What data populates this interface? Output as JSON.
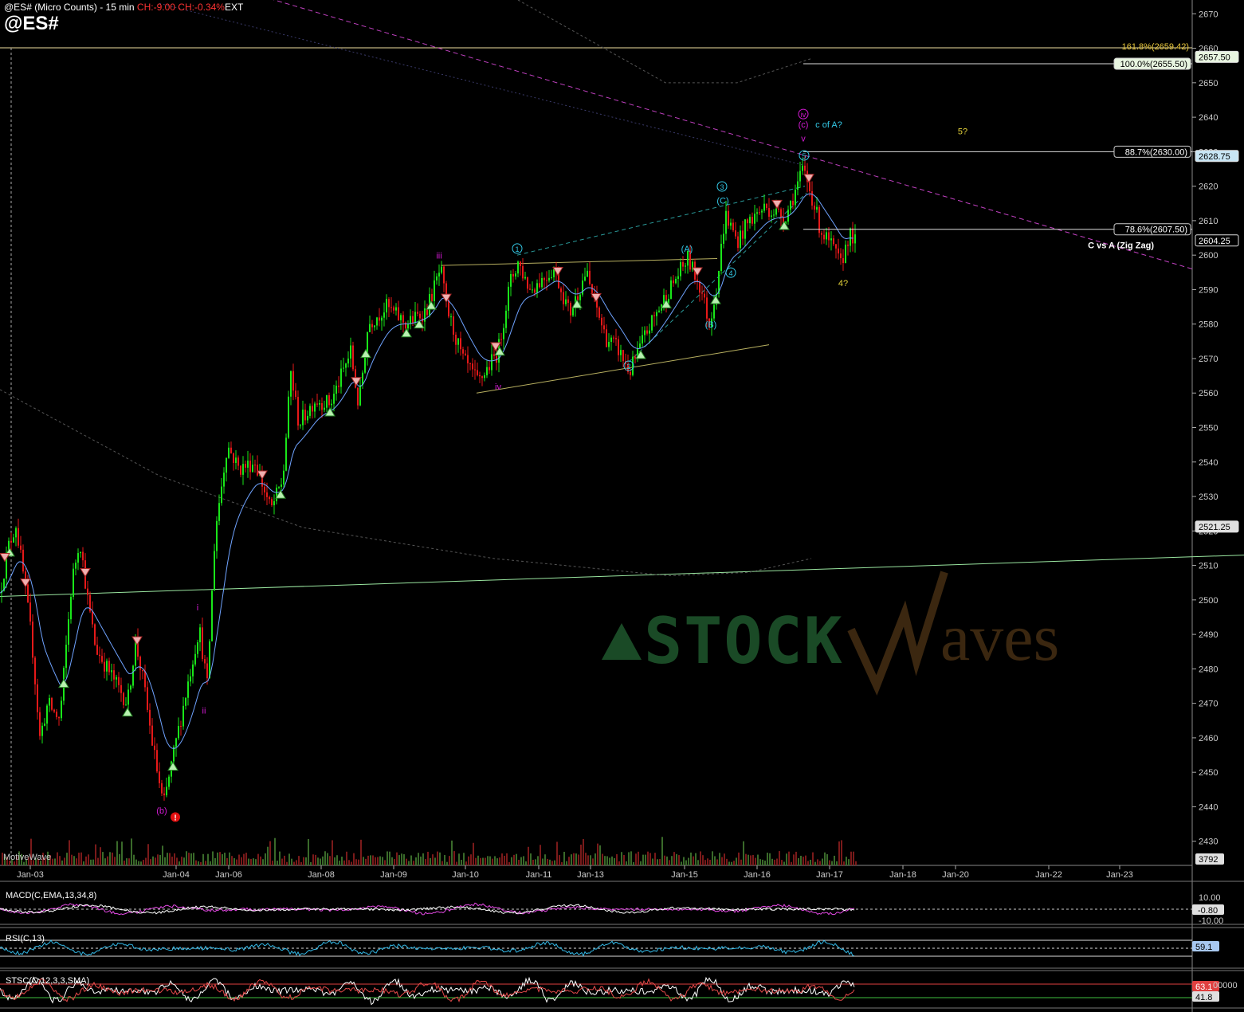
{
  "header": {
    "title": "@ES# (Micro Counts) - 15 min",
    "change_abs": "CH:-9.00",
    "change_pct": "CH:-0.34%",
    "session": "EXT",
    "symbol": "@ES#"
  },
  "footer": {
    "vendor": "MotiveWave"
  },
  "watermark": {
    "part1": "STOCK",
    "part2": "aves"
  },
  "colors": {
    "up_candle": "#19e619",
    "down_candle": "#e61919",
    "wave_cyan": "#33c8e6",
    "wave_magenta": "#d41ad4",
    "fib_label": "#e6c53a",
    "ma_line": "#6fa3ff"
  },
  "chart_data": [
    {
      "type": "candlestick",
      "title": "@ES# (Micro Counts) - 15 min",
      "price_axis": {
        "ticks": [
          2430,
          2440,
          2450,
          2460,
          2470,
          2480,
          2490,
          2500,
          2510,
          2520,
          2530,
          2540,
          2550,
          2560,
          2570,
          2580,
          2590,
          2600,
          2610,
          2620,
          2630,
          2640,
          2650,
          2660,
          2670
        ],
        "range": [
          2423,
          2674
        ],
        "badges": [
          {
            "value": 2657.5,
            "label": "2657.50"
          },
          {
            "value": 2628.75,
            "label": "2628.75"
          },
          {
            "value": 2604.25,
            "label": "2604.25"
          },
          {
            "value": 2521.25,
            "label": "2521.25"
          }
        ],
        "volume_badge": "3792"
      },
      "time_axis": [
        "Jan-03",
        "Jan-04",
        "Jan-06",
        "Jan-08",
        "Jan-09",
        "Jan-10",
        "Jan-11",
        "Jan-13",
        "Jan-15",
        "Jan-16",
        "Jan-17",
        "Jan-18",
        "Jan-20",
        "Jan-22",
        "Jan-23"
      ],
      "price_path": [
        {
          "t": 0,
          "p": 2502
        },
        {
          "t": 10,
          "p": 2515
        },
        {
          "t": 20,
          "p": 2522
        },
        {
          "t": 30,
          "p": 2506
        },
        {
          "t": 40,
          "p": 2488
        },
        {
          "t": 50,
          "p": 2460
        },
        {
          "t": 60,
          "p": 2470
        },
        {
          "t": 75,
          "p": 2465
        },
        {
          "t": 90,
          "p": 2505
        },
        {
          "t": 100,
          "p": 2518
        },
        {
          "t": 110,
          "p": 2500
        },
        {
          "t": 120,
          "p": 2486
        },
        {
          "t": 140,
          "p": 2478
        },
        {
          "t": 160,
          "p": 2470
        },
        {
          "t": 170,
          "p": 2488
        },
        {
          "t": 180,
          "p": 2476
        },
        {
          "t": 190,
          "p": 2460
        },
        {
          "t": 205,
          "p": 2440
        },
        {
          "t": 215,
          "p": 2452
        },
        {
          "t": 235,
          "p": 2475
        },
        {
          "t": 250,
          "p": 2492
        },
        {
          "t": 260,
          "p": 2475
        },
        {
          "t": 270,
          "p": 2520
        },
        {
          "t": 285,
          "p": 2545
        },
        {
          "t": 300,
          "p": 2538
        },
        {
          "t": 320,
          "p": 2540
        },
        {
          "t": 340,
          "p": 2526
        },
        {
          "t": 355,
          "p": 2535
        },
        {
          "t": 365,
          "p": 2566
        },
        {
          "t": 375,
          "p": 2551
        },
        {
          "t": 395,
          "p": 2558
        },
        {
          "t": 415,
          "p": 2557
        },
        {
          "t": 425,
          "p": 2563
        },
        {
          "t": 440,
          "p": 2572
        },
        {
          "t": 450,
          "p": 2556
        },
        {
          "t": 462,
          "p": 2580
        },
        {
          "t": 485,
          "p": 2585
        },
        {
          "t": 510,
          "p": 2580
        },
        {
          "t": 535,
          "p": 2584
        },
        {
          "t": 553,
          "p": 2596
        },
        {
          "t": 560,
          "p": 2585
        },
        {
          "t": 580,
          "p": 2570
        },
        {
          "t": 600,
          "p": 2563
        },
        {
          "t": 625,
          "p": 2572
        },
        {
          "t": 640,
          "p": 2592
        },
        {
          "t": 650,
          "p": 2598
        },
        {
          "t": 665,
          "p": 2590
        },
        {
          "t": 680,
          "p": 2593
        },
        {
          "t": 695,
          "p": 2596
        },
        {
          "t": 715,
          "p": 2583
        },
        {
          "t": 735,
          "p": 2595
        },
        {
          "t": 760,
          "p": 2576
        },
        {
          "t": 775,
          "p": 2573
        },
        {
          "t": 790,
          "p": 2566
        },
        {
          "t": 810,
          "p": 2577
        },
        {
          "t": 830,
          "p": 2586
        },
        {
          "t": 850,
          "p": 2594
        },
        {
          "t": 863,
          "p": 2599
        },
        {
          "t": 880,
          "p": 2590
        },
        {
          "t": 890,
          "p": 2580
        },
        {
          "t": 900,
          "p": 2592
        },
        {
          "t": 910,
          "p": 2612
        },
        {
          "t": 925,
          "p": 2604
        },
        {
          "t": 940,
          "p": 2610
        },
        {
          "t": 960,
          "p": 2614
        },
        {
          "t": 985,
          "p": 2611
        },
        {
          "t": 1000,
          "p": 2620
        },
        {
          "t": 1008,
          "p": 2625
        },
        {
          "t": 1020,
          "p": 2616
        },
        {
          "t": 1030,
          "p": 2607
        },
        {
          "t": 1045,
          "p": 2602
        },
        {
          "t": 1055,
          "p": 2597
        },
        {
          "t": 1065,
          "p": 2606
        },
        {
          "t": 1073,
          "p": 2604
        }
      ],
      "levels": [
        {
          "name": "161.8%",
          "value": 2659.42,
          "label": "161.8%(2659.42)"
        },
        {
          "name": "100.0%",
          "value": 2655.5,
          "label": "100.0%(2655.50)"
        },
        {
          "name": "88.7%",
          "value": 2630.0,
          "label": "88.7%(2630.00)"
        },
        {
          "name": "78.6%",
          "value": 2607.5,
          "label": "78.6%(2607.50)"
        }
      ],
      "annotations": [
        {
          "text": "C vs A (Zig Zag)",
          "t": 1448,
          "p": 2602
        },
        {
          "text": "c of A?",
          "t": 1040,
          "p": 2637
        },
        {
          "text": "5?",
          "t": 1208,
          "p": 2635
        },
        {
          "text": "4?",
          "t": 1058,
          "p": 2591
        },
        {
          "text": "(b)",
          "t": 203,
          "p": 2438
        },
        {
          "text": "i",
          "t": 248,
          "p": 2497
        },
        {
          "text": "ii",
          "t": 256,
          "p": 2467
        },
        {
          "text": "iii",
          "t": 551,
          "p": 2599
        },
        {
          "text": "iv",
          "t": 625,
          "p": 2561
        },
        {
          "text": "v",
          "t": 1008,
          "p": 2633
        },
        {
          "text": "(c)",
          "t": 1008,
          "p": 2637
        },
        {
          "text": "iv",
          "t": 1008,
          "p": 2640
        },
        {
          "text": "1",
          "t": 649,
          "p": 2601
        },
        {
          "text": "2",
          "t": 789,
          "p": 2567
        },
        {
          "text": "3",
          "t": 906,
          "p": 2619
        },
        {
          "text": "4",
          "t": 917,
          "p": 2594
        },
        {
          "text": "5",
          "t": 1009,
          "p": 2628
        },
        {
          "text": "(A)",
          "t": 862,
          "p": 2601
        },
        {
          "text": "(B)",
          "t": 892,
          "p": 2579
        },
        {
          "text": "(C)",
          "t": 907,
          "p": 2615
        }
      ]
    },
    {
      "type": "line",
      "title": "MACD(C,EMA,13,34,8)",
      "y_ticks": [
        "10.00",
        "-10.00"
      ],
      "badge": "-0.80"
    },
    {
      "type": "line",
      "title": "RSI(C,13)",
      "badge": "59.1"
    },
    {
      "type": "line",
      "title": "STSC(C,12,3,3,SMA)",
      "badges": [
        "63.1",
        "41.8"
      ],
      "y_ticks": [
        "00000"
      ]
    }
  ]
}
